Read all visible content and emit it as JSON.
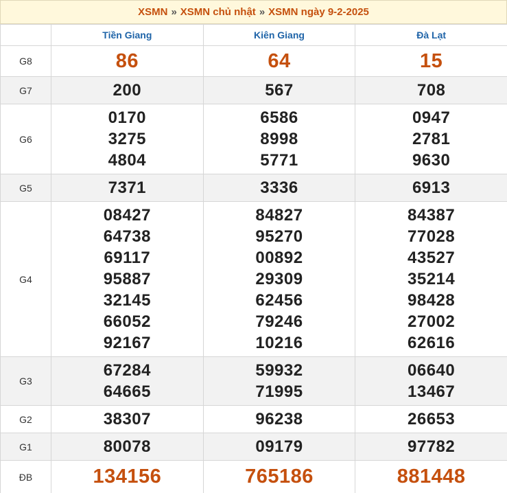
{
  "breadcrumb": {
    "item1": "XSMN",
    "item2": "XSMN chủ nhật",
    "item3": "XSMN ngày 9-2-2025",
    "separator": "»"
  },
  "provinces": [
    "Tiền Giang",
    "Kiên Giang",
    "Đà Lạt"
  ],
  "prizes": [
    {
      "label": "G8",
      "numbers": [
        [
          "86"
        ],
        [
          "64"
        ],
        [
          "15"
        ]
      ]
    },
    {
      "label": "G7",
      "numbers": [
        [
          "200"
        ],
        [
          "567"
        ],
        [
          "708"
        ]
      ]
    },
    {
      "label": "G6",
      "numbers": [
        [
          "0170",
          "3275",
          "4804"
        ],
        [
          "6586",
          "8998",
          "5771"
        ],
        [
          "0947",
          "2781",
          "9630"
        ]
      ]
    },
    {
      "label": "G5",
      "numbers": [
        [
          "7371"
        ],
        [
          "3336"
        ],
        [
          "6913"
        ]
      ]
    },
    {
      "label": "G4",
      "numbers": [
        [
          "08427",
          "64738",
          "69117",
          "95887",
          "32145",
          "66052",
          "92167"
        ],
        [
          "84827",
          "95270",
          "00892",
          "29309",
          "62456",
          "79246",
          "10216"
        ],
        [
          "84387",
          "77028",
          "43527",
          "35214",
          "98428",
          "27002",
          "62616"
        ]
      ]
    },
    {
      "label": "G3",
      "numbers": [
        [
          "67284",
          "64665"
        ],
        [
          "59932",
          "71995"
        ],
        [
          "06640",
          "13467"
        ]
      ]
    },
    {
      "label": "G2",
      "numbers": [
        [
          "38307"
        ],
        [
          "96238"
        ],
        [
          "26653"
        ]
      ]
    },
    {
      "label": "G1",
      "numbers": [
        [
          "80078"
        ],
        [
          "09179"
        ],
        [
          "97782"
        ]
      ]
    },
    {
      "label": "ĐB",
      "numbers": [
        [
          "134156"
        ],
        [
          "765186"
        ],
        [
          "881448"
        ]
      ]
    }
  ],
  "colors": {
    "accent": "#c5500e",
    "province_header": "#1f64a8",
    "title_bg": "#fff8dc",
    "shade_row": "#f2f2f2"
  }
}
